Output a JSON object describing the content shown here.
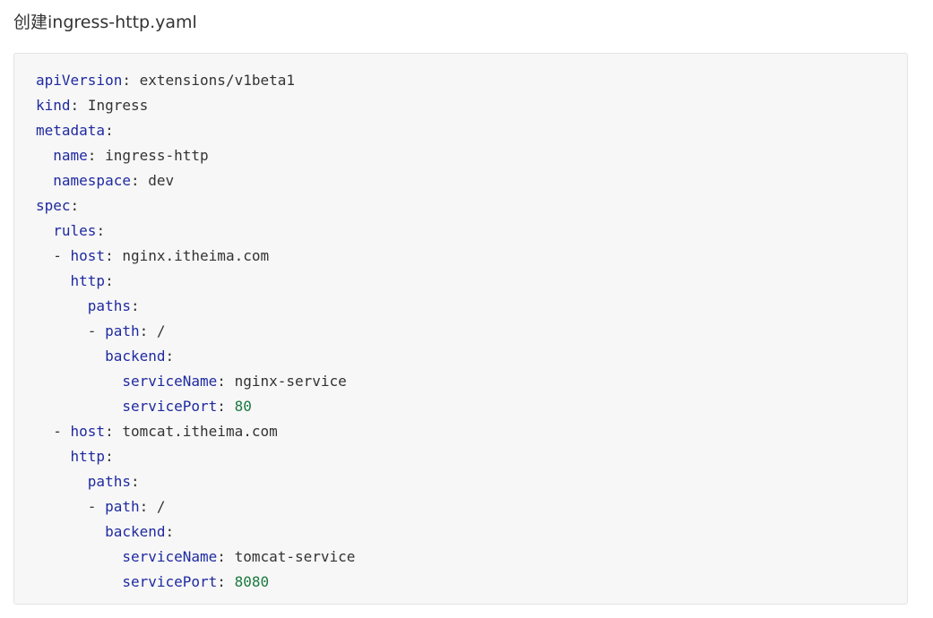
{
  "heading": "创建ingress-http.yaml",
  "colors": {
    "key": "#1f2aa0",
    "number": "#1a7a3f",
    "text": "#333333",
    "code_background": "#f7f7f7"
  },
  "code_lines": [
    {
      "indent": "",
      "dash": "",
      "key": "apiVersion",
      "value": "extensions/v1beta1",
      "value_type": "string"
    },
    {
      "indent": "",
      "dash": "",
      "key": "kind",
      "value": "Ingress",
      "value_type": "string"
    },
    {
      "indent": "",
      "dash": "",
      "key": "metadata",
      "value": "",
      "value_type": "none"
    },
    {
      "indent": "  ",
      "dash": "",
      "key": "name",
      "value": "ingress-http",
      "value_type": "string"
    },
    {
      "indent": "  ",
      "dash": "",
      "key": "namespace",
      "value": "dev",
      "value_type": "string"
    },
    {
      "indent": "",
      "dash": "",
      "key": "spec",
      "value": "",
      "value_type": "none"
    },
    {
      "indent": "  ",
      "dash": "",
      "key": "rules",
      "value": "",
      "value_type": "none"
    },
    {
      "indent": "  ",
      "dash": "- ",
      "key": "host",
      "value": "nginx.itheima.com",
      "value_type": "string"
    },
    {
      "indent": "    ",
      "dash": "",
      "key": "http",
      "value": "",
      "value_type": "none"
    },
    {
      "indent": "      ",
      "dash": "",
      "key": "paths",
      "value": "",
      "value_type": "none"
    },
    {
      "indent": "      ",
      "dash": "- ",
      "key": "path",
      "value": "/",
      "value_type": "string"
    },
    {
      "indent": "        ",
      "dash": "",
      "key": "backend",
      "value": "",
      "value_type": "none"
    },
    {
      "indent": "          ",
      "dash": "",
      "key": "serviceName",
      "value": "nginx-service",
      "value_type": "string"
    },
    {
      "indent": "          ",
      "dash": "",
      "key": "servicePort",
      "value": "80",
      "value_type": "number"
    },
    {
      "indent": "  ",
      "dash": "- ",
      "key": "host",
      "value": "tomcat.itheima.com",
      "value_type": "string"
    },
    {
      "indent": "    ",
      "dash": "",
      "key": "http",
      "value": "",
      "value_type": "none"
    },
    {
      "indent": "      ",
      "dash": "",
      "key": "paths",
      "value": "",
      "value_type": "none"
    },
    {
      "indent": "      ",
      "dash": "- ",
      "key": "path",
      "value": "/",
      "value_type": "string"
    },
    {
      "indent": "        ",
      "dash": "",
      "key": "backend",
      "value": "",
      "value_type": "none"
    },
    {
      "indent": "          ",
      "dash": "",
      "key": "serviceName",
      "value": "tomcat-service",
      "value_type": "string"
    },
    {
      "indent": "          ",
      "dash": "",
      "key": "servicePort",
      "value": "8080",
      "value_type": "number"
    }
  ]
}
